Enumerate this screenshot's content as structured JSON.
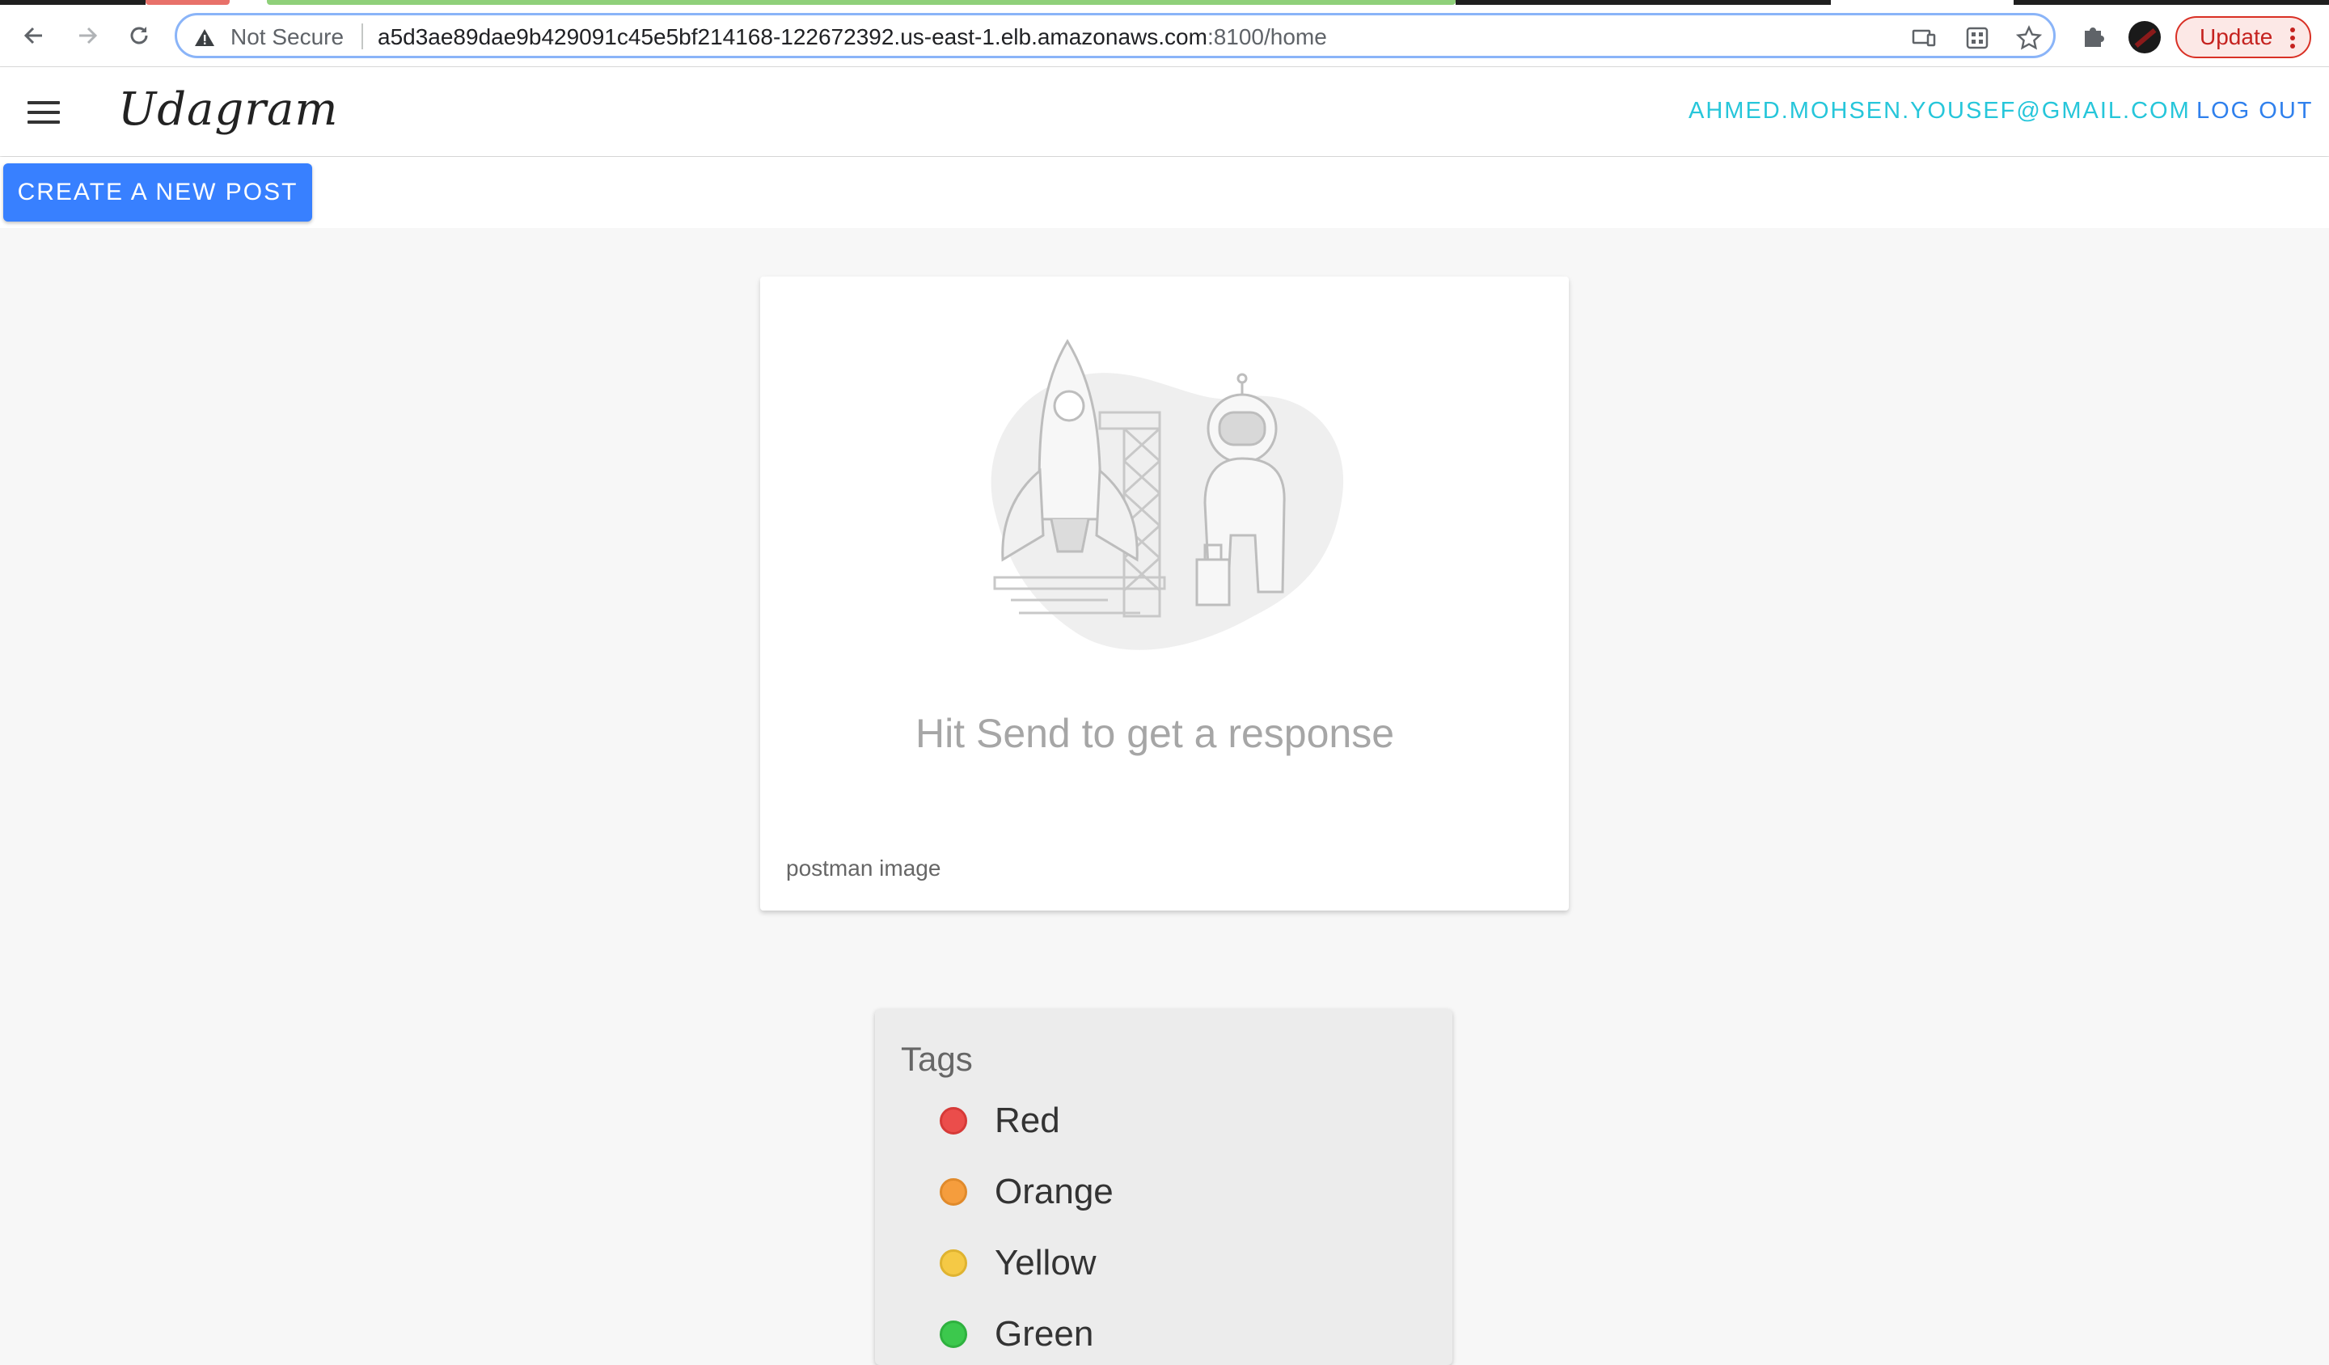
{
  "browser": {
    "security_label": "Not Secure",
    "url_host": "a5d3ae89dae9b429091c45e5bf214168-122672392.us-east-1.elb.amazonaws.com",
    "url_path": ":8100/home",
    "update_label": "Update"
  },
  "app": {
    "brand": "Udagram",
    "user_email": "AHMED.MOHSEN.YOUSEF@GMAIL.COM",
    "logout_label": "LOG OUT",
    "create_post_label": "CREATE A NEW POST"
  },
  "feed": {
    "items": [
      {
        "image_text": "Hit Send to get a response",
        "caption": "postman image"
      }
    ]
  },
  "tags": {
    "title": "Tags",
    "items": [
      {
        "label": "Red",
        "color": "#eb4d4b",
        "border": "#d63a38"
      },
      {
        "label": "Orange",
        "color": "#f59d3d",
        "border": "#e08a2b"
      },
      {
        "label": "Yellow",
        "color": "#f5c945",
        "border": "#dfb330"
      },
      {
        "label": "Green",
        "color": "#3cc84d",
        "border": "#2fb13f"
      }
    ]
  },
  "colors": {
    "accent": "#3880ff",
    "email": "#26c6da",
    "logout": "#2f80ed"
  }
}
